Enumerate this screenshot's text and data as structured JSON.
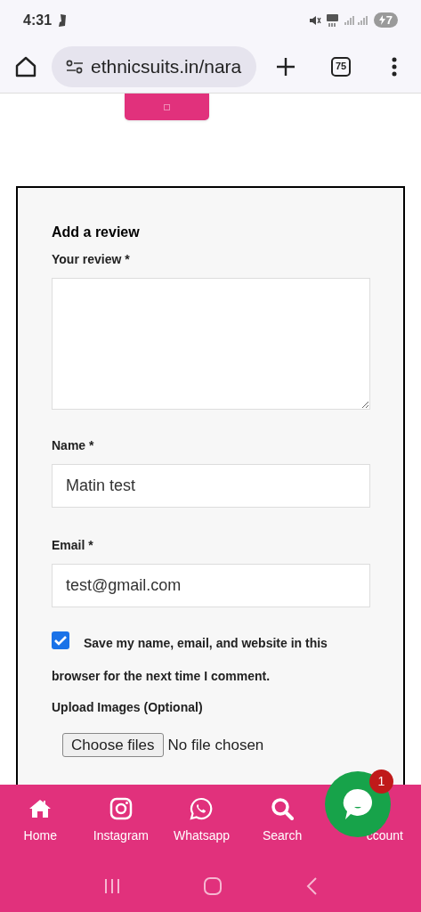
{
  "status_bar": {
    "time": "4:31",
    "battery": "7"
  },
  "browser": {
    "url": "ethnicsuits.in/nara",
    "tab_count": "75"
  },
  "review_form": {
    "title": "Add a review",
    "review_label": "Your review *",
    "name_label": "Name *",
    "name_value": "Matin test",
    "email_label": "Email *",
    "email_value": "test@gmail.com",
    "save_info": {
      "checked": true,
      "label_lines": [
        "Save my name, email, and website in this",
        "browser for the next time I comment."
      ]
    },
    "upload_label": "Upload Images (Optional)",
    "file_button": "Choose files",
    "file_status": "No file chosen"
  },
  "bottom_nav": [
    {
      "kind": "home",
      "label": "Home"
    },
    {
      "kind": "instagram",
      "label": "Instagram"
    },
    {
      "kind": "whatsapp",
      "label": "Whatsapp"
    },
    {
      "kind": "search",
      "label": "Search"
    },
    {
      "kind": "account",
      "label": "ccount"
    }
  ],
  "chat_widget": {
    "badge": "1"
  }
}
